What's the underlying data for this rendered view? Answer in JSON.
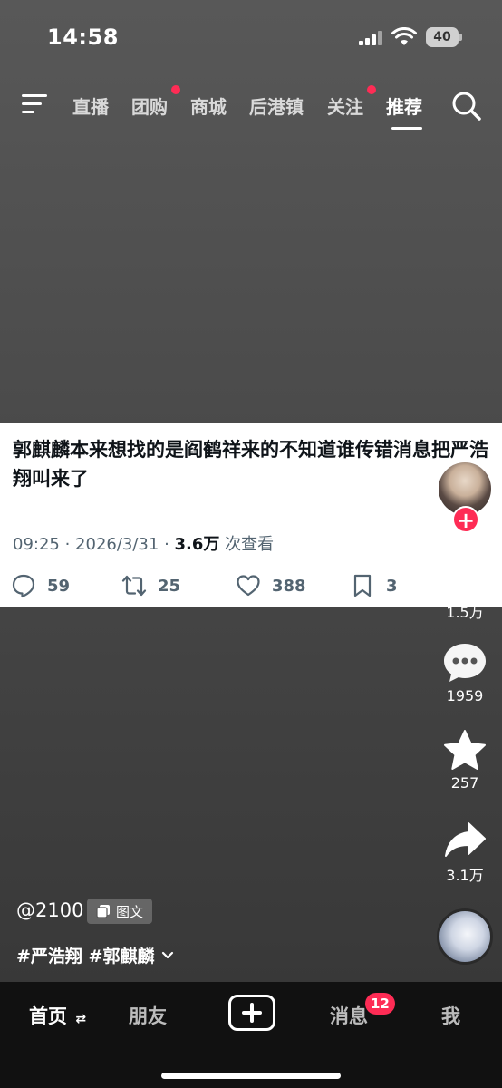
{
  "status_bar": {
    "time": "14:58",
    "battery": "40"
  },
  "top_nav": {
    "tabs": [
      {
        "label": "直播",
        "dot": false
      },
      {
        "label": "团购",
        "dot": true
      },
      {
        "label": "商城",
        "dot": false
      },
      {
        "label": "后港镇",
        "dot": false
      },
      {
        "label": "关注",
        "dot": true
      },
      {
        "label": "推荐",
        "dot": false,
        "active": true
      }
    ]
  },
  "post": {
    "text": "郭麒麟本来想找的是阎鹤祥来的不知道谁传错消息把严浩翔叫来了",
    "time": "09:25",
    "date": "2026/3/31",
    "views": "3.6万",
    "views_suffix": "次查看",
    "replies": "59",
    "retweets": "25",
    "likes": "388",
    "bookmarks": "3"
  },
  "sidebar": {
    "likes": "1.5万",
    "comments": "1959",
    "favorites": "257",
    "shares": "3.1万"
  },
  "info": {
    "author": "@2100",
    "type_badge": "图文",
    "tags": "#严浩翔 #郭麒麟"
  },
  "bottom_nav": {
    "home": "首页",
    "friends": "朋友",
    "messages": "消息",
    "messages_badge": "12",
    "me": "我"
  },
  "colors": {
    "accent": "#fe2c55",
    "card_bg": "#ffffff",
    "nav_bg": "#111111"
  }
}
